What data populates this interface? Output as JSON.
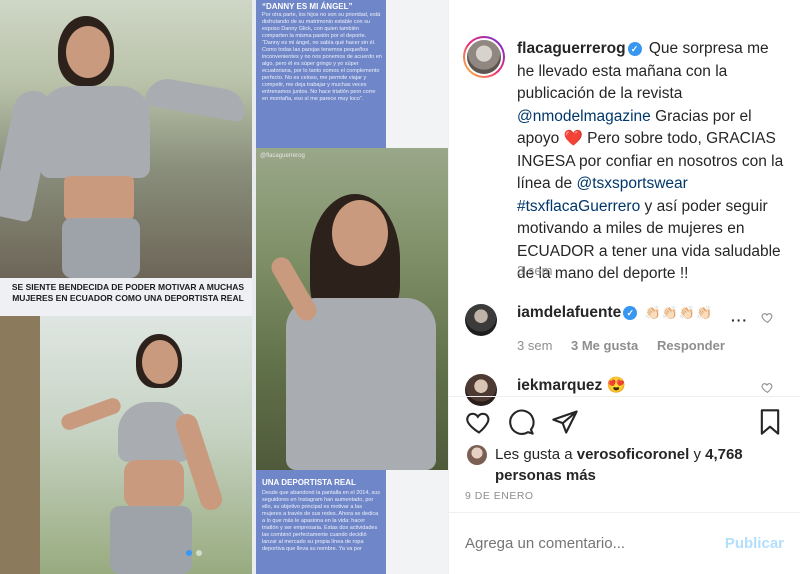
{
  "magazine": {
    "caption": "SE SIENTE BENDECIDA DE PODER MOTIVAR A MUCHAS MUJERES EN ECUADOR COMO UNA DEPORTISTA REAL",
    "top_heading": "“DANNY ES MI ÁNGEL”",
    "top_body": "Por otra parte, los hijos no son su prioridad, está disfrutando de su matrimonio estable con su esposo Danny Glick, con quien también comparten la misma pasión por el deporte. “Danny es mi ángel, no sabía qué hacer sin él. Como todas las parejas tenemos pequeños inconvenientes y no nos ponemos de acuerdo en algo, pero él es súper gringo y yo súper ecuatoriana, por lo tanto somos el complemento perfecto. No es celoso, me permite viajar y competir, me deja trabajar y muchas veces entrenamos juntos. No hace triatlón pero corre en montaña, eso sí me parece muy loco”.",
    "handle": "@flacaguerrerog",
    "bottom_heading": "UNA DEPORTISTA REAL",
    "bottom_body": "Desde que abandonó la pantalla en el 2014, sus seguidores en Instagram han aumentado, por ello, su objetivo principal es motivar a las mujeres a través de sus redes. Ahora se dedica a lo que más le apasiona en la vida: hacer triatlón y ser empresaria. Estas dos actividades las combinó perfectamente cuando decidió lanzar al mercado su propia línea de ropa deportiva que lleva su nombre. Ya va por"
  },
  "post": {
    "author": "flacaguerrerog",
    "caption_parts": {
      "p1": "Que sorpresa me he llevado esta mañana con la publicación de la revista",
      "mention1": "@nmodelmagazine",
      "p2": "Gracias por el apoyo",
      "heart": "❤️",
      "p3": "Pero sobre todo, GRACIAS INGESA por confiar en nosotros con la línea de",
      "mention2": "@tsxsportswear",
      "hashtag": "#tsxflacaGuerrero",
      "p4": "y así poder seguir motivando a miles de mujeres en ECUADOR a tener una vida saludable de la mano del deporte !!"
    },
    "caption_time": "3 sem"
  },
  "comments": [
    {
      "user": "iamdelafuente",
      "text": "👏🏻👏🏻👏🏻👏🏻",
      "time": "3 sem",
      "likes": "3 Me gusta",
      "reply": "Responder"
    },
    {
      "user": "iekmarquez",
      "text": "😍"
    }
  ],
  "likes": {
    "prefix": "Les gusta a",
    "user": "verosoficoronel",
    "conj": "y",
    "count": "4,768 personas más"
  },
  "date": "9 DE ENERO",
  "comment_box": {
    "placeholder": "Agrega un comentario...",
    "publish": "Publicar"
  },
  "icons": {
    "like": "heart-outline-icon",
    "comment": "speech-bubble-icon",
    "share": "paper-plane-icon",
    "save": "bookmark-icon",
    "more": "ellipsis-icon"
  },
  "colors": {
    "link": "#00376b",
    "verified": "#3897f0",
    "publish_disabled": "#b2dffc",
    "muted": "#8e8e8e"
  }
}
